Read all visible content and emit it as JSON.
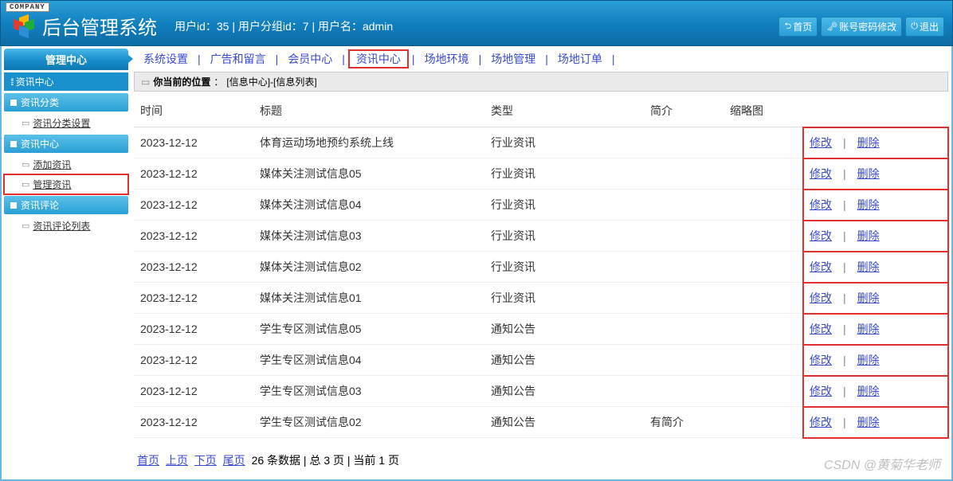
{
  "header": {
    "badge": "COMPANY",
    "title": "后台管理系统",
    "user_info": "用户id：35 | 用户分组id：7 | 用户名：admin",
    "actions": {
      "home": "首页",
      "password": "账号密码修改",
      "logout": "退出"
    }
  },
  "sidebar": {
    "main_header": "管理中心",
    "sub_title": "资讯中心",
    "sections": [
      {
        "title": "资讯分类",
        "items": [
          "资讯分类设置"
        ]
      },
      {
        "title": "资讯中心",
        "items": [
          "添加资讯",
          "管理资讯"
        ]
      },
      {
        "title": "资讯评论",
        "items": [
          "资讯评论列表"
        ]
      }
    ]
  },
  "topnav": {
    "items": [
      "系统设置",
      "广告和留言",
      "会员中心",
      "资讯中心",
      "场地环境",
      "场地管理",
      "场地订单"
    ],
    "active_index": 3
  },
  "breadcrumb": {
    "label": "你当前的位置",
    "path": "[信息中心]-[信息列表]"
  },
  "table": {
    "headers": [
      "时间",
      "标题",
      "类型",
      "简介",
      "缩略图",
      ""
    ],
    "action_edit": "修改",
    "action_delete": "删除",
    "rows": [
      {
        "time": "2023-12-12",
        "title": "体育运动场地预约系统上线",
        "type": "行业资讯",
        "intro": "",
        "thumb": ""
      },
      {
        "time": "2023-12-12",
        "title": "媒体关注测试信息05",
        "type": "行业资讯",
        "intro": "",
        "thumb": ""
      },
      {
        "time": "2023-12-12",
        "title": "媒体关注测试信息04",
        "type": "行业资讯",
        "intro": "",
        "thumb": ""
      },
      {
        "time": "2023-12-12",
        "title": "媒体关注测试信息03",
        "type": "行业资讯",
        "intro": "",
        "thumb": ""
      },
      {
        "time": "2023-12-12",
        "title": "媒体关注测试信息02",
        "type": "行业资讯",
        "intro": "",
        "thumb": ""
      },
      {
        "time": "2023-12-12",
        "title": "媒体关注测试信息01",
        "type": "行业资讯",
        "intro": "",
        "thumb": ""
      },
      {
        "time": "2023-12-12",
        "title": "学生专区测试信息05",
        "type": "通知公告",
        "intro": "",
        "thumb": ""
      },
      {
        "time": "2023-12-12",
        "title": "学生专区测试信息04",
        "type": "通知公告",
        "intro": "",
        "thumb": ""
      },
      {
        "time": "2023-12-12",
        "title": "学生专区测试信息03",
        "type": "通知公告",
        "intro": "",
        "thumb": ""
      },
      {
        "time": "2023-12-12",
        "title": "学生专区测试信息02",
        "type": "通知公告",
        "intro": "有简介",
        "thumb": ""
      }
    ]
  },
  "pagination": {
    "first": "首页",
    "prev": "上页",
    "next": "下页",
    "last": "尾页",
    "info": "26 条数据 | 总 3 页 | 当前 1 页"
  },
  "watermark": "CSDN @黄菊华老师"
}
